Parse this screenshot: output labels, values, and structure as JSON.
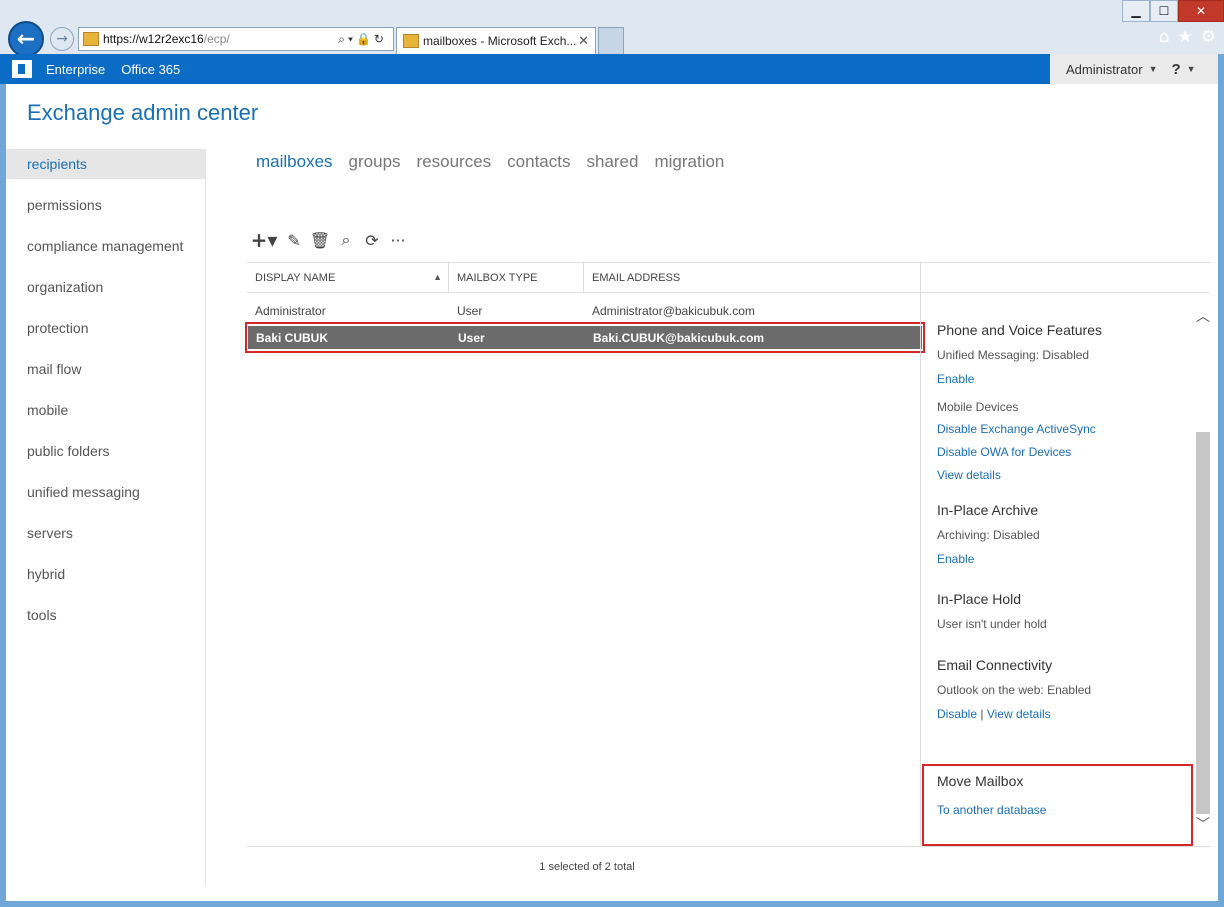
{
  "browser": {
    "url_host": "https://w12r2exc16",
    "url_path": "/ecp/",
    "tab_title": "mailboxes - Microsoft Exch...",
    "tab_close": "✕",
    "win_min": "▁",
    "win_max": "☐",
    "win_close": "✕",
    "back": "←",
    "forward": "→",
    "addr_tools": "⌕▾🔒↻",
    "home_icon": "⌂",
    "star_icon": "★",
    "gear_icon": "⚙"
  },
  "topbar": {
    "enterprise": "Enterprise",
    "office365": "Office 365",
    "user": "Administrator",
    "user_caret": "▼",
    "help": "?",
    "help_caret": "▼"
  },
  "app": {
    "title": "Exchange admin center"
  },
  "leftnav": {
    "items": [
      "recipients",
      "permissions",
      "compliance management",
      "organization",
      "protection",
      "mail flow",
      "mobile",
      "public folders",
      "unified messaging",
      "servers",
      "hybrid",
      "tools"
    ]
  },
  "subtabs": [
    "mailboxes",
    "groups",
    "resources",
    "contacts",
    "shared",
    "migration"
  ],
  "toolbar": {
    "plus": "+▾",
    "edit": "✎",
    "delete": "🗑",
    "search": "⌕",
    "refresh": "⟳",
    "more": "···"
  },
  "grid": {
    "headers": [
      "DISPLAY NAME",
      "MAILBOX TYPE",
      "EMAIL ADDRESS"
    ],
    "sort_arrow": "▲",
    "rows": [
      {
        "name": "Administrator",
        "type": "User",
        "email": "Administrator@bakicubuk.com"
      },
      {
        "name": "Baki CUBUK",
        "type": "User",
        "email": "Baki.CUBUK@bakicubuk.com"
      }
    ],
    "status": "1 selected of 2 total"
  },
  "details": {
    "phone_head": "Phone and Voice Features",
    "um_text": "Unified Messaging:  Disabled",
    "um_enable": "Enable",
    "mobile_head": "Mobile Devices",
    "disable_eas": "Disable Exchange ActiveSync",
    "disable_owa": "Disable OWA for Devices",
    "view_details_mobile": "View details",
    "archive_head": "In-Place Archive",
    "archive_text": "Archiving:  Disabled",
    "archive_enable": "Enable",
    "hold_head": "In-Place Hold",
    "hold_text": "User isn't under hold",
    "email_head": "Email Connectivity",
    "owa_text": "Outlook on the web:  Enabled",
    "owa_disable": "Disable",
    "owa_sep": "|",
    "owa_view": "View details",
    "move_head": "Move Mailbox",
    "move_link": "To another database"
  },
  "scroll": {
    "up": "︿",
    "down": "﹀"
  }
}
